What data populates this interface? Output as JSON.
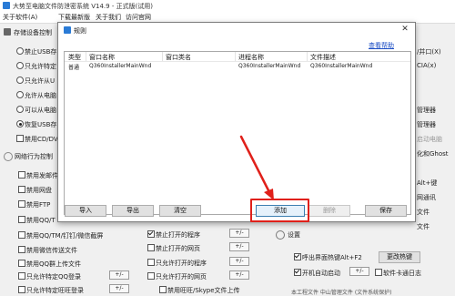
{
  "window": {
    "title": "大势至电脑文件防泄密系统 V14.9 - 正式版(试用)"
  },
  "menubar": [
    {
      "label": "关于软件(A)"
    },
    {
      "label": "下载最新版"
    },
    {
      "label": "关于我们"
    },
    {
      "label": "访问官网"
    }
  ],
  "left_panel": {
    "storage_header": "存储设备控制",
    "radios": [
      {
        "label": "禁止USB存",
        "checked": false
      },
      {
        "label": "只允许特定",
        "checked": false
      },
      {
        "label": "只允许从U",
        "checked": false
      },
      {
        "label": "允许从电脑",
        "checked": false
      },
      {
        "label": "可以从电脑",
        "checked": false
      },
      {
        "label": "恢复USB存",
        "checked": true
      }
    ],
    "cd_checkbox": "禁用CD/DV",
    "network_header": "网络行为控制",
    "network_items": [
      {
        "label": "禁用发邮件"
      },
      {
        "label": "禁用网盘"
      },
      {
        "label": "禁用FTP"
      },
      {
        "label": "禁用QQ/T"
      },
      {
        "label": "禁用QQ/TM/钉钉/微信截屏"
      },
      {
        "label": "禁用微信传送文件"
      },
      {
        "label": "禁用QQ群上传文件"
      },
      {
        "label": "只允许特定QQ登录",
        "pm": "+/-"
      },
      {
        "label": "只允许特定旺旺登录",
        "pm": "+/-"
      }
    ],
    "middle_items": [
      {
        "label": "禁止打开的程序",
        "checked": true,
        "pm": "+/-"
      },
      {
        "label": "禁止打开的网页",
        "checked": false,
        "pm": "+/-"
      },
      {
        "label": "只允许打开的程序",
        "checked": false,
        "pm": "+/-"
      },
      {
        "label": "只允许打开的网页",
        "checked": false,
        "pm": "+/-"
      },
      {
        "label": "禁用旺旺/Skype文件上传",
        "checked": false
      }
    ]
  },
  "right_panel": {
    "fragments": [
      "/并口(X)",
      "CIA(x)",
      "管理器",
      "管理器",
      "启动电脑",
      "化和Ghost",
      "Alt+键",
      "网通讯",
      "文件",
      "文件"
    ],
    "settings_header": "设置",
    "settings_items": [
      {
        "label": "呼出界面热键Alt+F2",
        "checked": true
      },
      {
        "label": "开机自动启动",
        "checked": true
      },
      {
        "label": "软件卡通日志",
        "checked": false
      }
    ],
    "hotkey_button": "更改热键",
    "pm": "+/-",
    "bottom_note": "本工程文件 中山管理文件  (文件系统保护)"
  },
  "dialog": {
    "title": "规则",
    "close_label": "✕",
    "help_link": "查看帮助",
    "columns": [
      "类型",
      "窗口名称",
      "窗口类名",
      "进程名称",
      "文件描述"
    ],
    "rows": [
      [
        "普通",
        "Q360InstallerMainWnd",
        "",
        "Q360InstallerMainWnd",
        "Q360InstallerMainWnd"
      ]
    ],
    "buttons": {
      "import": "导入",
      "export": "导出",
      "clear": "清空",
      "add": "添加",
      "delete": "删除",
      "save": "保存"
    },
    "delete_disabled": true
  },
  "annotation": {
    "color": "#e0201a"
  }
}
